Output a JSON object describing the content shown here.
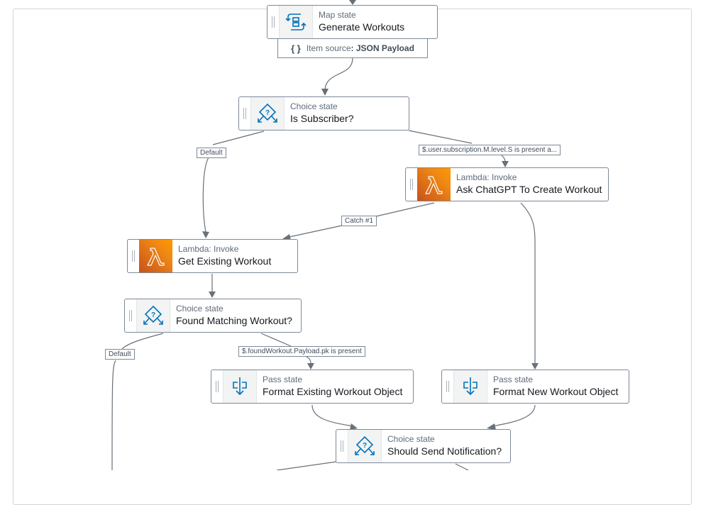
{
  "diagram": {
    "states": {
      "generate_workouts": {
        "type": "Map state",
        "name": "Generate Workouts",
        "icon": "map-state-icon",
        "item_source_label": "Item source",
        "item_source_value": ": JSON Payload"
      },
      "is_subscriber": {
        "type": "Choice state",
        "name": "Is Subscriber?",
        "icon": "choice-state-icon"
      },
      "ask_chatgpt": {
        "type": "Lambda: Invoke",
        "name": "Ask ChatGPT To Create Workout",
        "icon": "lambda-icon"
      },
      "get_existing": {
        "type": "Lambda: Invoke",
        "name": "Get Existing Workout",
        "icon": "lambda-icon"
      },
      "found_matching": {
        "type": "Choice state",
        "name": "Found Matching Workout?",
        "icon": "choice-state-icon"
      },
      "format_existing": {
        "type": "Pass state",
        "name": "Format Existing Workout Object",
        "icon": "pass-state-icon"
      },
      "format_new": {
        "type": "Pass state",
        "name": "Format New Workout Object",
        "icon": "pass-state-icon"
      },
      "should_notify": {
        "type": "Choice state",
        "name": "Should Send Notification?",
        "icon": "choice-state-icon"
      }
    },
    "edge_labels": {
      "default_1": "Default",
      "subscription_rule": "$.user.subscription.M.level.S is present a...",
      "catch_1": "Catch #1",
      "default_2": "Default",
      "found_workout_rule": "$.foundWorkout.Payload.pk is present"
    },
    "colors": {
      "edge": "#687078",
      "node_border": "#7d8998",
      "icon_blue": "#0073bb",
      "lambda_orange": "#f08a14"
    }
  }
}
